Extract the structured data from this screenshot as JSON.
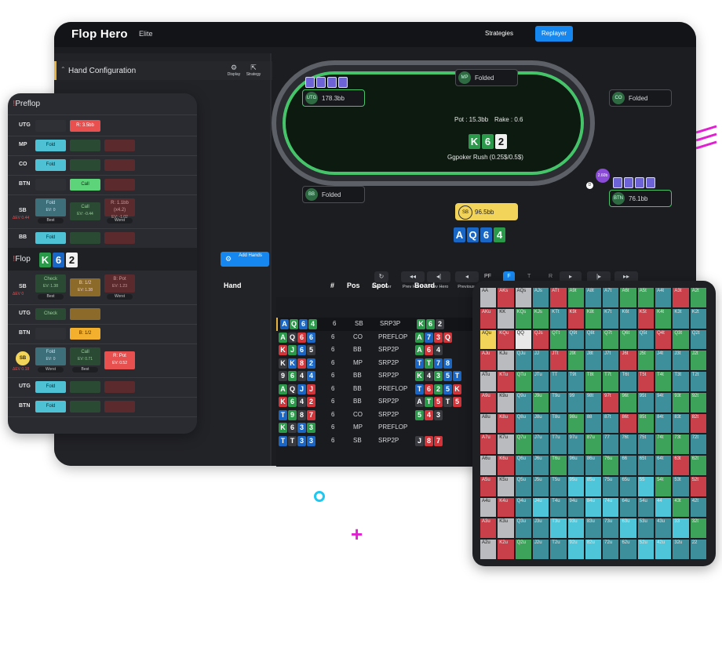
{
  "app": {
    "logo": "Flop Hero",
    "tier": "Elite",
    "nav": {
      "strategies": "Strategies",
      "replayer": "Replayer"
    }
  },
  "hand_config": {
    "title": "Hand Configuration",
    "display": "Display",
    "strategy": "Strategy"
  },
  "table": {
    "pot": "Pot : 15.3bb",
    "rake": "Rake : 0.6",
    "room": "Ggpoker Rush (0.25$/0.5$)",
    "board": [
      {
        "r": "K",
        "s": "c"
      },
      {
        "r": "6",
        "s": "c"
      },
      {
        "r": "2",
        "s": "s"
      }
    ],
    "hero_cards": [
      {
        "r": "A",
        "s": "d"
      },
      {
        "r": "Q",
        "s": "d"
      },
      {
        "r": "6",
        "s": "d"
      },
      {
        "r": "4",
        "s": "c"
      }
    ],
    "bet_chip": "2.60b",
    "dealer": "D",
    "seats": {
      "mp": {
        "pos": "MP",
        "status": "Folded"
      },
      "utg": {
        "pos": "UTG",
        "status": "178.3bb"
      },
      "co": {
        "pos": "CO",
        "status": "Folded"
      },
      "sb_left": {
        "pos": "BB",
        "status": "Folded"
      },
      "btn": {
        "pos": "BTN",
        "status": "76.1bb"
      },
      "sb": {
        "pos": "SB",
        "status": "96.5bb"
      }
    }
  },
  "controls": {
    "add_hands": "Add Hands",
    "start_over": "Start Over",
    "prev_hand": "Prev Hand",
    "prev_hero": "Prev Hero",
    "previous": "Previous",
    "streets": [
      "PF",
      "F",
      "T",
      "R"
    ]
  },
  "hand_list": {
    "headers": {
      "hand": "Hand",
      "num": "#",
      "pos": "Pos",
      "spot": "Spot",
      "board": "Board"
    },
    "rows": [
      {
        "hand": [
          [
            "A",
            "d"
          ],
          [
            "Q",
            "c"
          ],
          [
            "6",
            "d"
          ],
          [
            "4",
            "c"
          ]
        ],
        "num": "6",
        "pos": "SB",
        "spot": "SRP3P",
        "board": [
          [
            "K",
            "c"
          ],
          [
            "6",
            "c"
          ],
          [
            "2",
            "s"
          ]
        ]
      },
      {
        "hand": [
          [
            "A",
            "c"
          ],
          [
            "Q",
            "s"
          ],
          [
            "6",
            "h"
          ],
          [
            "6",
            "d"
          ]
        ],
        "num": "6",
        "pos": "CO",
        "spot": "PREFLOP",
        "board": [
          [
            "A",
            "c"
          ],
          [
            "7",
            "d"
          ],
          [
            "3",
            "h"
          ],
          [
            "Q",
            "h"
          ]
        ]
      },
      {
        "hand": [
          [
            "K",
            "h"
          ],
          [
            "J",
            "c"
          ],
          [
            "6",
            "d"
          ],
          [
            "5",
            "s"
          ]
        ],
        "num": "6",
        "pos": "BB",
        "spot": "SRP2P",
        "board": [
          [
            "A",
            "c"
          ],
          [
            "6",
            "h"
          ],
          [
            "4",
            "s"
          ]
        ]
      },
      {
        "hand": [
          [
            "K",
            "s"
          ],
          [
            "K",
            "d"
          ],
          [
            "8",
            "h"
          ],
          [
            "2",
            "d"
          ]
        ],
        "num": "6",
        "pos": "MP",
        "spot": "SRP2P",
        "board": [
          [
            "T",
            "d"
          ],
          [
            "T",
            "c"
          ],
          [
            "7",
            "d"
          ],
          [
            "8",
            "d"
          ]
        ]
      },
      {
        "hand": [
          [
            "9",
            "s"
          ],
          [
            "6",
            "c"
          ],
          [
            "4",
            "s"
          ],
          [
            "4",
            "d"
          ]
        ],
        "num": "6",
        "pos": "BB",
        "spot": "SRP2P",
        "board": [
          [
            "K",
            "c"
          ],
          [
            "4",
            "s"
          ],
          [
            "3",
            "c"
          ],
          [
            "5",
            "d"
          ],
          [
            "T",
            "d"
          ]
        ]
      },
      {
        "hand": [
          [
            "A",
            "c"
          ],
          [
            "Q",
            "s"
          ],
          [
            "J",
            "d"
          ],
          [
            "J",
            "h"
          ]
        ],
        "num": "6",
        "pos": "BB",
        "spot": "PREFLOP",
        "board": [
          [
            "T",
            "d"
          ],
          [
            "6",
            "h"
          ],
          [
            "2",
            "c"
          ],
          [
            "5",
            "d"
          ],
          [
            "K",
            "h"
          ]
        ]
      },
      {
        "hand": [
          [
            "K",
            "h"
          ],
          [
            "6",
            "c"
          ],
          [
            "4",
            "s"
          ],
          [
            "2",
            "h"
          ]
        ],
        "num": "6",
        "pos": "BB",
        "spot": "SRP2P",
        "board": [
          [
            "A",
            "s"
          ],
          [
            "T",
            "c"
          ],
          [
            "5",
            "h"
          ],
          [
            "T",
            "s"
          ],
          [
            "5",
            "h"
          ]
        ]
      },
      {
        "hand": [
          [
            "T",
            "d"
          ],
          [
            "9",
            "c"
          ],
          [
            "8",
            "s"
          ],
          [
            "7",
            "h"
          ]
        ],
        "num": "6",
        "pos": "CO",
        "spot": "SRP2P",
        "board": [
          [
            "5",
            "c"
          ],
          [
            "4",
            "h"
          ],
          [
            "3",
            "s"
          ]
        ]
      },
      {
        "hand": [
          [
            "K",
            "c"
          ],
          [
            "6",
            "s"
          ],
          [
            "3",
            "d"
          ],
          [
            "3",
            "c"
          ]
        ],
        "num": "6",
        "pos": "MP",
        "spot": "PREFLOP",
        "board": []
      },
      {
        "hand": [
          [
            "T",
            "d"
          ],
          [
            "T",
            "s"
          ],
          [
            "3",
            "d"
          ],
          [
            "3",
            "d"
          ]
        ],
        "num": "6",
        "pos": "SB",
        "spot": "SRP2P",
        "board": [
          [
            "J",
            "s"
          ],
          [
            "8",
            "h"
          ],
          [
            "7",
            "h"
          ]
        ]
      }
    ]
  },
  "preflop": {
    "title": "Preflop",
    "rows": [
      {
        "pos": "UTG",
        "actions": [
          {
            "label": "",
            "style": "empty"
          },
          {
            "label": "R: 3.5bb",
            "style": "red"
          }
        ]
      },
      {
        "pos": "MP",
        "actions": [
          {
            "label": "Fold",
            "style": "cyan"
          },
          {
            "label": "",
            "style": "green-d"
          },
          {
            "label": "",
            "style": "red-d"
          }
        ]
      },
      {
        "pos": "CO",
        "actions": [
          {
            "label": "Fold",
            "style": "cyan"
          },
          {
            "label": "",
            "style": "green-d"
          },
          {
            "label": "",
            "style": "red-d"
          }
        ]
      },
      {
        "pos": "BTN",
        "actions": [
          {
            "label": "",
            "style": "empty"
          },
          {
            "label": "Call",
            "style": "green"
          },
          {
            "label": "",
            "style": "red-d"
          }
        ]
      },
      {
        "pos": "SB",
        "ev": "ΔEV 0.44",
        "actions": [
          {
            "label": "Fold",
            "sub": "EV: 0",
            "style": "mid",
            "tag": "Best"
          },
          {
            "label": "Call",
            "sub": "EV: -0.44",
            "style": "green-d"
          },
          {
            "label": "R: 1.1bb (x4.2)",
            "sub": "EV: -1.02",
            "style": "red-d",
            "tag": "Worst"
          }
        ]
      },
      {
        "pos": "BB",
        "actions": [
          {
            "label": "Fold",
            "style": "cyan"
          },
          {
            "label": "",
            "style": "green-d"
          },
          {
            "label": "",
            "style": "red-d"
          }
        ]
      }
    ]
  },
  "flop": {
    "title": "Flop",
    "board": [
      {
        "r": "K",
        "s": "c"
      },
      {
        "r": "6",
        "s": "d"
      },
      {
        "r": "2",
        "s": "s"
      }
    ],
    "rows": [
      {
        "pos": "SB",
        "ev": "ΔEV 0",
        "actions": [
          {
            "label": "Check",
            "sub": "EV: 1.38",
            "style": "green-d",
            "tag": "Best"
          },
          {
            "label": "B: 1/2",
            "sub": "EV: 1.38",
            "style": "orange-d"
          },
          {
            "label": "B: Pot",
            "sub": "EV: 1.23",
            "style": "red-d",
            "tag": "Worst"
          }
        ]
      },
      {
        "pos": "UTG",
        "actions": [
          {
            "label": "Check",
            "style": "green-d"
          },
          {
            "label": "",
            "style": "orange-d"
          }
        ]
      },
      {
        "pos": "BTN",
        "actions": [
          {
            "label": "",
            "style": "empty"
          },
          {
            "label": "B: 1/2",
            "style": "orange"
          }
        ]
      },
      {
        "pos": "SB",
        "hero": true,
        "ev": "ΔEV 0.18",
        "actions": [
          {
            "label": "Fold",
            "sub": "EV: 0",
            "style": "mid",
            "tag": "Worst"
          },
          {
            "label": "Call",
            "sub": "EV: 0.71",
            "style": "green-d",
            "tag": "Best"
          },
          {
            "label": "R: Pot",
            "sub": "EV: 0.52",
            "style": "red"
          }
        ]
      },
      {
        "pos": "UTG",
        "actions": [
          {
            "label": "Fold",
            "style": "cyan"
          },
          {
            "label": "",
            "style": "green-d"
          },
          {
            "label": "",
            "style": "red-d"
          }
        ]
      },
      {
        "pos": "BTN",
        "actions": [
          {
            "label": "Fold",
            "style": "cyan"
          },
          {
            "label": "",
            "style": "green-d"
          },
          {
            "label": "",
            "style": "red-d"
          }
        ]
      }
    ]
  },
  "range": {
    "ranks": [
      "A",
      "K",
      "Q",
      "J",
      "T",
      "9",
      "8",
      "7",
      "6",
      "5",
      "4",
      "3",
      "2"
    ],
    "highlight": "AQu",
    "colors": {
      "fold": "#3e8f9c",
      "call": "#3ea35a",
      "raise": "#c9404a",
      "cyan": "#4ec5d8",
      "gray": "#b9bbbe",
      "yellow": "#f2d45a"
    }
  }
}
